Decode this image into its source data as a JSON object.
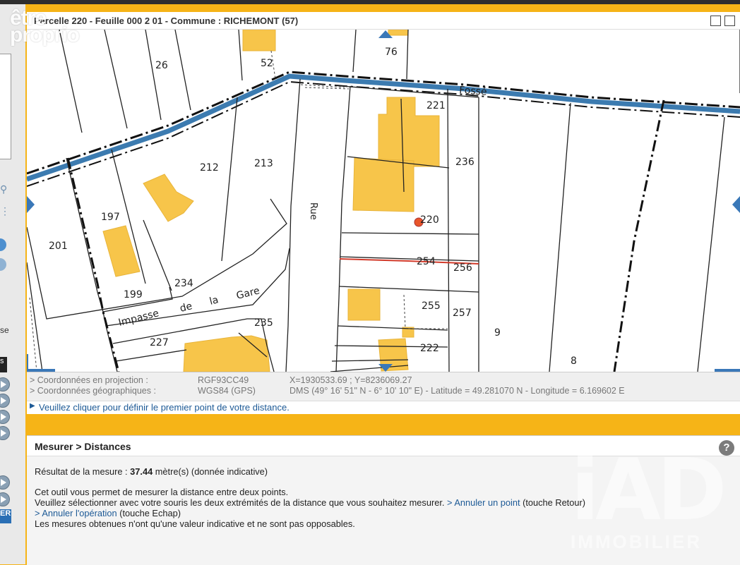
{
  "watermark": {
    "brand_top": "être",
    "brand_bottom": "proprio"
  },
  "window": {
    "title": "Parcelle 220 - Feuille 000 2 01 - Commune : RICHEMONT (57)"
  },
  "left_panel": {
    "fragment_se": "se",
    "fragment_s": "s",
    "fragment_er": "ER"
  },
  "map": {
    "parcels": [
      "26",
      "52",
      "76",
      "221",
      "236",
      "212",
      "213",
      "197",
      "201",
      "220",
      "254",
      "256",
      "199",
      "234",
      "255",
      "257",
      "9",
      "235",
      "227",
      "222",
      "8"
    ],
    "street_rue": "Rue",
    "street_impasse": [
      "Impasse",
      "de",
      "la",
      "Gare"
    ],
    "fosse": "Fossé",
    "measure_length_m": 37.44
  },
  "coords": {
    "proj_label": "> Coordonnées en projection :",
    "proj_system": "RGF93CC49",
    "proj_value": "X=1930533.69 ; Y=8236069.27",
    "geo_label": "> Coordonnées géographiques :",
    "geo_system": "WGS84 (GPS)",
    "geo_value": "DMS (49° 16' 51\" N - 6° 10' 10\" E) - Latitude = 49.281070 N - Longitude = 6.169602 E",
    "instruction": "Veuillez cliquer pour définir le premier point de votre distance."
  },
  "panel": {
    "title": "Mesurer > Distances",
    "result_prefix": "Résultat de la mesure : ",
    "result_value": "37.44",
    "result_suffix": " mètre(s)   (donnée indicative)",
    "line1": "Cet outil vous permet de mesurer la distance entre deux points.",
    "line2": "Veuillez sélectionner avec votre souris les deux extrémités de la distance que vous souhaitez mesurer. ",
    "link_undo_point": "> Annuler un point",
    "line2_end": " (touche Retour)",
    "link_cancel": "> Annuler l'opération",
    "line3_end": " (touche Echap)",
    "line4": "Les mesures obtenues n'ont qu'une valeur indicative et ne sont pas opposables.",
    "help": "?"
  },
  "iad_watermark": {
    "logo": "iAD",
    "sub": "IMMOBILIER"
  },
  "colors": {
    "frame": "#f6b417",
    "building": "#f7c54a",
    "canal": "#3c7bb0",
    "measure": "#d23a2a",
    "nav_arrow": "#3a78b8"
  }
}
